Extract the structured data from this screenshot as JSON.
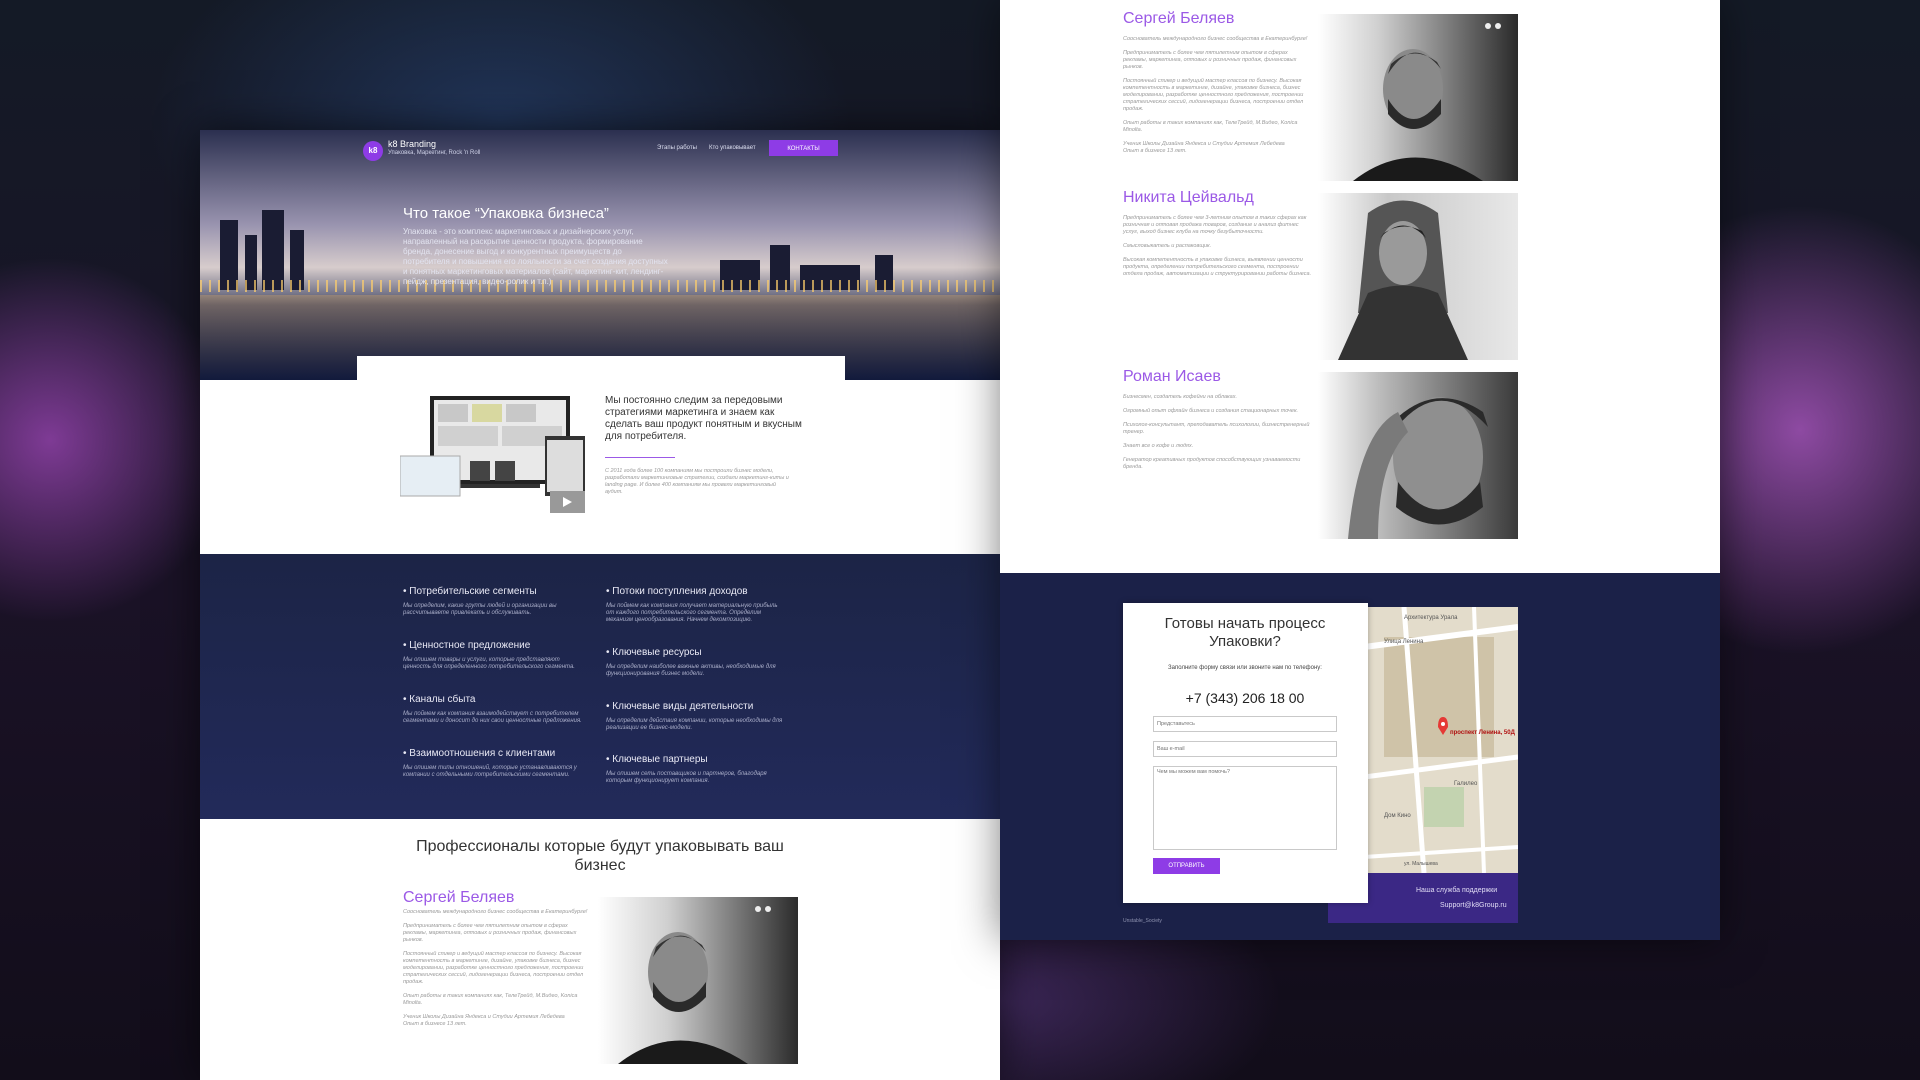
{
  "nav": {
    "brand": "k8 Branding",
    "tagline": "Упаковка, Маркетинг, Rock 'n Roll",
    "logo_text": "k8",
    "links": [
      "Этапы работы",
      "Кто упаковывает"
    ],
    "cta": "КОНТАКТЫ"
  },
  "hero": {
    "title": "Что такое “Упаковка бизнеса”",
    "text": "Упаковка - это комплекс маркетинговых и дизайнерских услуг, направленный на раскрытие ценности продукта, формирование бренда, донесение выгод и конкурентных преимуществ до потребителя и повышения его лояльности за счет создания доступных и понятных маркетинговых материалов (сайт, маркетинг-кит, лендинг-пейдж, презентация, видео-ролик и т.п.)"
  },
  "intro": {
    "title": "Мы постоянно следим за передовыми стратегиями маркетинга и знаем как сделать ваш продукт понятным и вкусным для потребителя.",
    "note": "С 2011 года более 100 компаниям мы построили бизнес модели, разработали маркетинговые стратегии, создали маркетинг-киты и landing page. И более 400 компаниям мы провели маркетинговый аудит."
  },
  "canvas": {
    "left": [
      {
        "title": "• Потребительские сегменты",
        "desc": "Мы определим, какие группы людей и организации вы рассчитываете привлекать и обслуживать."
      },
      {
        "title": "• Ценностное предложение",
        "desc": "Мы опишем товары и услуги, которые представляют ценность для определенного потребительского сегмента."
      },
      {
        "title": "• Каналы сбыта",
        "desc": "Мы поймем как компания взаимодействует с потребителем сегментами и доносит до них свои ценностные предложения."
      },
      {
        "title": "• Взаимоотношения с клиентами",
        "desc": "Мы опишем типы отношений, которые устанавливаются у компании с отдельными потребительскими сегментами."
      }
    ],
    "right": [
      {
        "title": "• Потоки поступления доходов",
        "desc": "Мы поймем как компания получает материальную прибыль от каждого потребительского сегмента. Определим механизм ценообразования. Начнем декомпозицию."
      },
      {
        "title": "• Ключевые ресурсы",
        "desc": "Мы определим наиболее важные активы, необходимые для функционирования бизнес модели."
      },
      {
        "title": "• Ключевые виды деятельности",
        "desc": "Мы определим действия компании, которые необходимы для реализации ее бизнес-модели."
      },
      {
        "title": "• Ключевые партнеры",
        "desc": "Мы опишем сеть поставщиков и партнеров, благодаря которым функционирует компания."
      }
    ]
  },
  "team": {
    "heading": "Профессионалы которые будут упаковывать ваш бизнес",
    "members": [
      {
        "name": "Сергей Беляев",
        "bio": "Сооснователь международного бизнес сообщества в Екатеринбурге!\n\nПредприниматель с более чем пятилетним опытом в сферах рекламы, маркетинга, оптовых и розничных продаж, финансовых рынков.\n\nПостоянный спикер и ведущий мастер классов по бизнесу. Высокая компетентность в маркетинге, дизайне, упаковке бизнеса, бизнес моделировании, разработке ценностного предложения, построении стратегических сессий, лидогенерации бизнеса, построении отдел продаж.\n\nОпыт работы в таких компаниях как, ТелеТрейд, М.Видео, Konica Minolta.\n\nУченик Школы Дизайна Яндекса и Студии Артемия Лебедева\nОпыт в бизнесе 13 лет."
      },
      {
        "name": "Никита Цейвальд",
        "bio": "Предприниматель с более чем 3-летним опытом в таких сферах как розничная и оптовая продажа товаров, создание и анализ фитнес услуг, выход бизнес клуба на точку безубыточности.\n\nСмысловыкатель и распаковщик.\n\nВысокая компетентность в упаковке бизнеса, выявлении ценности продукта, определении потребительского сегмента, построении отдела продаж, автоматизации и структурировании работы бизнеса."
      },
      {
        "name": "Роман Исаев",
        "bio": "Бизнесмен, создатель кофейни на облаках.\n\nОгромный опыт офлайн бизнеса и создания стационарных точек.\n\nПсихолог-консультант, преподаватель психологии, бизнестренерный тренер.\n\nЗнает все о кофе и людях.\n\nГенератор креативных продуктов способствующих узнаваемости бренда."
      }
    ]
  },
  "contact": {
    "title": "Готовы начать процесс Упаковки?",
    "subtitle": "Заполните форму связи или звоните нам по телефону:",
    "phone": "+7 (343) 206 18 00",
    "name_placeholder": "Представьтесь",
    "email_placeholder": "Ваш e-mail",
    "message_placeholder": "Чем мы можем вам помочь?",
    "submit": "ОТПРАВИТЬ",
    "support_title": "Наша служба поддержки",
    "support_email": "Support@k8Group.ru",
    "footer": "Unstable_Society",
    "map_address": "проспект Ленина, 50Д",
    "map_labels": [
      "Архитектура Урала",
      "Улица Ленина",
      "Галилео",
      "Дом Кино",
      "ул. Малышева"
    ]
  },
  "colors": {
    "accent": "#8e3ce6",
    "accent_text": "#9b59e6",
    "dark_band": "#1b2148"
  }
}
